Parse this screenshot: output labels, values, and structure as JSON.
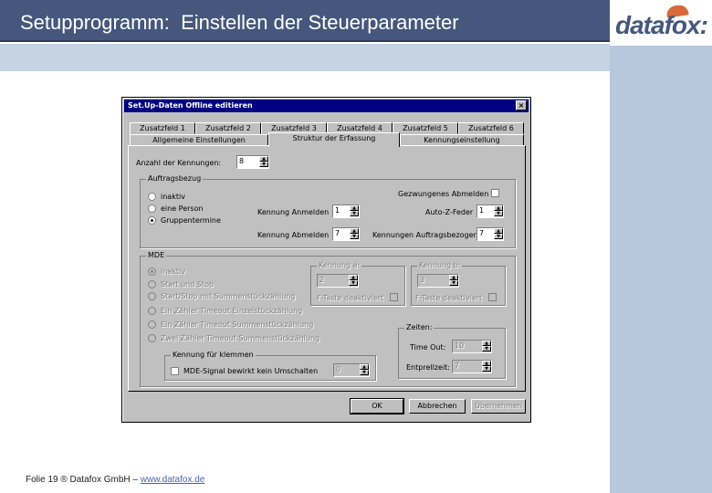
{
  "slide": {
    "title": "Setupprogramm:  Einstellen der Steuerparameter",
    "logo": "datafox:",
    "footer_text": "Folie 19 ® Datafox GmbH – ",
    "footer_link": "www.datafox.de"
  },
  "dialog": {
    "title": "Set.Up-Daten Offline editieren",
    "close": "×",
    "tabs_row1": [
      "Zusatzfeld 1",
      "Zusatzfeld 2",
      "Zusatzfeld 3",
      "Zusatzfeld 4",
      "Zusatzfeld 5",
      "Zusatzfeld 6"
    ],
    "tabs_row2": [
      "Allgemeine Einstellungen",
      "Struktur der Erfassung",
      "Kennungseinstellung"
    ],
    "anzahl_label": "Anzahl der Kennungen:",
    "anzahl_value": "8",
    "auftrag": {
      "title": "Auftragsbezug",
      "radios": [
        "inaktiv",
        "eine Person",
        "Gruppentermine"
      ],
      "gezwungen_label": "Gezwungenes Abmelden",
      "kennung_anmelden_label": "Kennung Anmelden",
      "kennung_anmelden_value": "1",
      "kennung_abmelden_label": "Kennung Abmelden",
      "kennung_abmelden_value": "7",
      "autoz_label": "Auto-Z-Feder",
      "autoz_value": "1",
      "kennungen_auftrag_label": "Kennungen Auftragsbezogen",
      "kennungen_auftrag_value": "7"
    },
    "mde": {
      "title": "MDE",
      "radios": [
        "inaktiv",
        "Start und Stop",
        "Start/Stop mit Summenstückzählung",
        "Ein Zähler Timeout Einzelstückzählung",
        "Ein Zähler Timeout Summenstückzählung",
        "Zwei Zähler Timeout Summenstückzählung"
      ],
      "kennung_a": {
        "title": "Kennung a:",
        "value": "2",
        "taste": "F-Taste deaktiviert"
      },
      "kennung_b": {
        "title": "Kennung b:",
        "value": "3",
        "taste": "F-Taste deaktiviert"
      },
      "zeiten": {
        "title": "Zeiten:",
        "timeout_label": "Time Out:",
        "timeout_value": "10",
        "entprell_label": "Entprellzeit:",
        "entprell_value": "7"
      },
      "kennung_klemmen": {
        "title": "Kennung für klemmen",
        "check_label": "MDE-Signal bewirkt kein Umschalten",
        "value": "0"
      }
    },
    "buttons": {
      "ok": "OK",
      "cancel": "Abbrechen",
      "apply": "Übernehmen"
    }
  }
}
